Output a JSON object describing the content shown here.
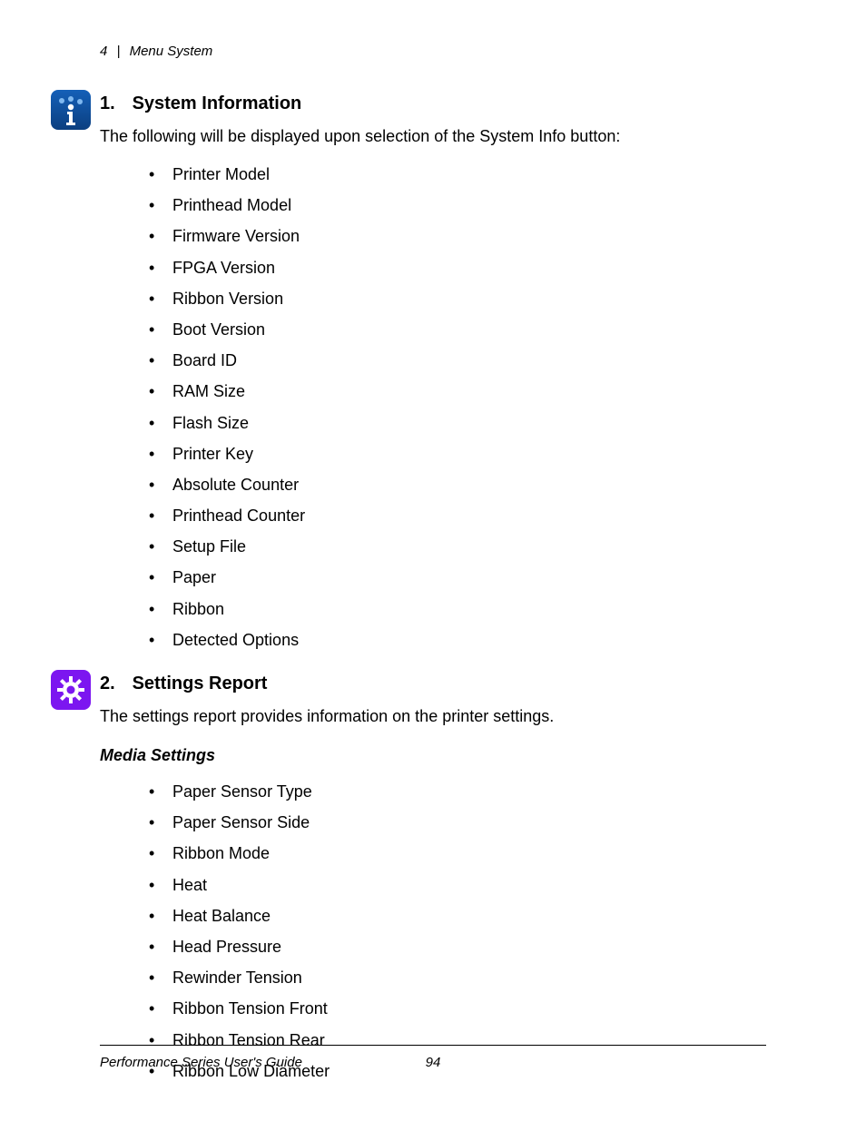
{
  "header": {
    "chapter_number": "4",
    "separator": "|",
    "chapter_title": "Menu System"
  },
  "sections": [
    {
      "number": "1.",
      "title": "System Information",
      "intro": "The following will be displayed upon selection of the System Info button:",
      "icon": "info-icon",
      "bullets": [
        "Printer Model",
        "Printhead Model",
        "Firmware Version",
        "FPGA Version",
        "Ribbon Version",
        "Boot Version",
        "Board ID",
        "RAM Size",
        "Flash Size",
        "Printer Key",
        "Absolute Counter",
        "Printhead Counter",
        "Setup File",
        "Paper",
        "Ribbon",
        "Detected Options"
      ]
    },
    {
      "number": "2.",
      "title": "Settings Report",
      "intro": "The settings report provides information on the printer settings.",
      "icon": "gear-icon",
      "subsections": [
        {
          "title": "Media Settings",
          "bullets": [
            "Paper Sensor Type",
            "Paper Sensor Side",
            "Ribbon Mode",
            "Heat",
            "Heat Balance",
            "Head Pressure",
            "Rewinder Tension",
            "Ribbon Tension Front",
            "Ribbon Tension Rear",
            "Ribbon Low Diameter"
          ]
        }
      ]
    }
  ],
  "footer": {
    "title": "Performance Series User's Guide",
    "page": "94"
  }
}
